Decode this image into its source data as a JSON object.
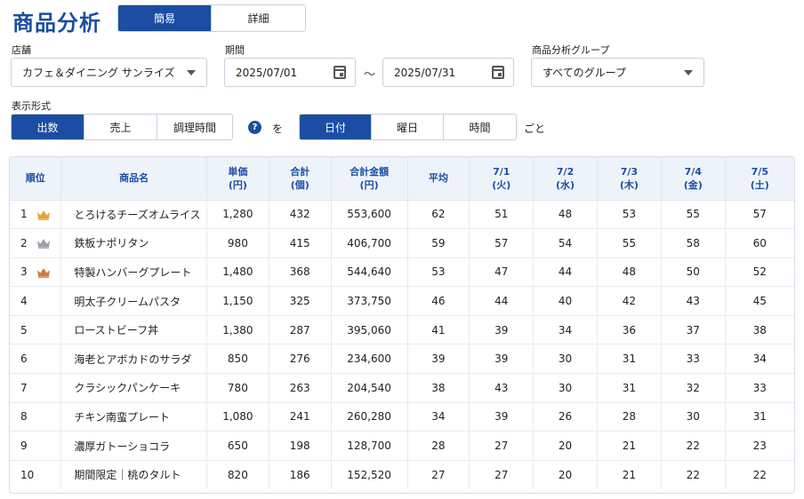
{
  "page": {
    "title": "商品分析"
  },
  "view_mode": {
    "options": [
      "簡易",
      "詳細"
    ],
    "selected": "簡易"
  },
  "filters": {
    "store": {
      "label": "店舗",
      "value": "カフェ＆ダイニング サンライズ"
    },
    "period": {
      "label": "期間",
      "start": "2025/07/01",
      "end": "2025/07/31",
      "separator": "～"
    },
    "group": {
      "label": "商品分析グループ",
      "value": "すべてのグループ"
    }
  },
  "display_format": {
    "label": "表示形式",
    "options": [
      "出数",
      "売上",
      "調理時間"
    ],
    "selected": "出数"
  },
  "help": {
    "symbol": "?"
  },
  "connector": "を",
  "period_unit": {
    "options": [
      "日付",
      "曜日",
      "時間"
    ],
    "selected": "日付"
  },
  "suffix": "ごと",
  "colors": {
    "accent": "#1b4ea3",
    "gold": "#e8a52a",
    "silver": "#9aa0a6",
    "bronze": "#d07a3c"
  },
  "table": {
    "headers": [
      [
        "順位"
      ],
      [
        "商品名"
      ],
      [
        "単価",
        "(円)"
      ],
      [
        "合計",
        "(個)"
      ],
      [
        "合計金額",
        "(円)"
      ],
      [
        "平均"
      ],
      [
        "7/1",
        "(火)"
      ],
      [
        "7/2",
        "(水)"
      ],
      [
        "7/3",
        "(木)"
      ],
      [
        "7/4",
        "(金)"
      ],
      [
        "7/5",
        "(土)"
      ]
    ],
    "rows": [
      {
        "rank": "1",
        "crown": "gold-crown-icon",
        "name": "とろけるチーズオムライス",
        "price": "1,280",
        "total": "432",
        "amount": "553,600",
        "avg": "62",
        "days": [
          "51",
          "48",
          "53",
          "55",
          "57"
        ]
      },
      {
        "rank": "2",
        "crown": "silver-crown-icon",
        "name": "鉄板ナポリタン",
        "price": "980",
        "total": "415",
        "amount": "406,700",
        "avg": "59",
        "days": [
          "57",
          "54",
          "55",
          "58",
          "60"
        ]
      },
      {
        "rank": "3",
        "crown": "bronze-crown-icon",
        "name": "特製ハンバーグプレート",
        "price": "1,480",
        "total": "368",
        "amount": "544,640",
        "avg": "53",
        "days": [
          "47",
          "44",
          "48",
          "50",
          "52"
        ]
      },
      {
        "rank": "4",
        "crown": "",
        "name": "明太子クリームパスタ",
        "price": "1,150",
        "total": "325",
        "amount": "373,750",
        "avg": "46",
        "days": [
          "44",
          "40",
          "42",
          "43",
          "45"
        ]
      },
      {
        "rank": "5",
        "crown": "",
        "name": "ローストビーフ丼",
        "price": "1,380",
        "total": "287",
        "amount": "395,060",
        "avg": "41",
        "days": [
          "39",
          "34",
          "36",
          "37",
          "38"
        ]
      },
      {
        "rank": "6",
        "crown": "",
        "name": "海老とアボカドのサラダ",
        "price": "850",
        "total": "276",
        "amount": "234,600",
        "avg": "39",
        "days": [
          "39",
          "30",
          "31",
          "33",
          "34"
        ]
      },
      {
        "rank": "7",
        "crown": "",
        "name": "クラシックパンケーキ",
        "price": "780",
        "total": "263",
        "amount": "204,540",
        "avg": "38",
        "days": [
          "43",
          "30",
          "31",
          "32",
          "33"
        ]
      },
      {
        "rank": "8",
        "crown": "",
        "name": "チキン南蛮プレート",
        "price": "1,080",
        "total": "241",
        "amount": "260,280",
        "avg": "34",
        "days": [
          "39",
          "26",
          "28",
          "30",
          "31"
        ]
      },
      {
        "rank": "9",
        "crown": "",
        "name": "濃厚ガトーショコラ",
        "price": "650",
        "total": "198",
        "amount": "128,700",
        "avg": "28",
        "days": [
          "27",
          "20",
          "21",
          "22",
          "23"
        ]
      },
      {
        "rank": "10",
        "crown": "",
        "name": "期間限定｜桃のタルト",
        "price": "820",
        "total": "186",
        "amount": "152,520",
        "avg": "27",
        "days": [
          "27",
          "20",
          "21",
          "22",
          "22"
        ]
      }
    ]
  }
}
